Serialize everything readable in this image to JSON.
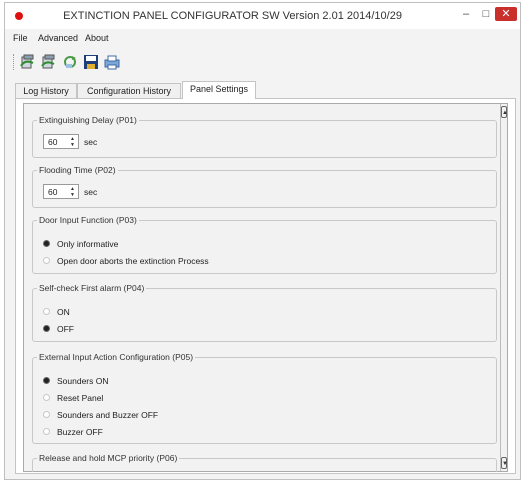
{
  "window": {
    "title": "EXTINCTION PANEL CONFIGURATOR SW Version 2.01 2014/10/29",
    "minimize": "–",
    "maximize": "□",
    "close": "✕"
  },
  "menu": [
    "File",
    "Advanced",
    "About"
  ],
  "toolbar": {
    "icons": [
      "connect-icon",
      "disconnect-icon",
      "refresh-icon",
      "save-icon",
      "print-icon"
    ]
  },
  "tabs": [
    {
      "label": "Log History",
      "active": false
    },
    {
      "label": "Configuration History",
      "active": false
    },
    {
      "label": "Panel Settings",
      "active": true
    }
  ],
  "settings": {
    "p01": {
      "title": "Extinguishing Delay (P01)",
      "value": "60",
      "unit": "sec"
    },
    "p02": {
      "title": "Flooding Time (P02)",
      "value": "60",
      "unit": "sec"
    },
    "p03": {
      "title": "Door Input Function (P03)",
      "options": [
        {
          "label": "Only informative",
          "selected": true
        },
        {
          "label": "Open door aborts the extinction Process",
          "selected": false
        }
      ]
    },
    "p04": {
      "title": "Self-check First alarm (P04)",
      "options": [
        {
          "label": "ON",
          "selected": false
        },
        {
          "label": "OFF",
          "selected": true
        }
      ]
    },
    "p05": {
      "title": "External Input Action Configuration (P05)",
      "options": [
        {
          "label": "Sounders ON",
          "selected": true
        },
        {
          "label": "Reset Panel",
          "selected": false
        },
        {
          "label": "Sounders and Buzzer OFF",
          "selected": false
        },
        {
          "label": "Buzzer OFF",
          "selected": false
        }
      ]
    },
    "p06": {
      "title": "Release and hold MCP priority (P06)"
    }
  },
  "scrollbar": {
    "up": "▲",
    "down": "▼"
  }
}
